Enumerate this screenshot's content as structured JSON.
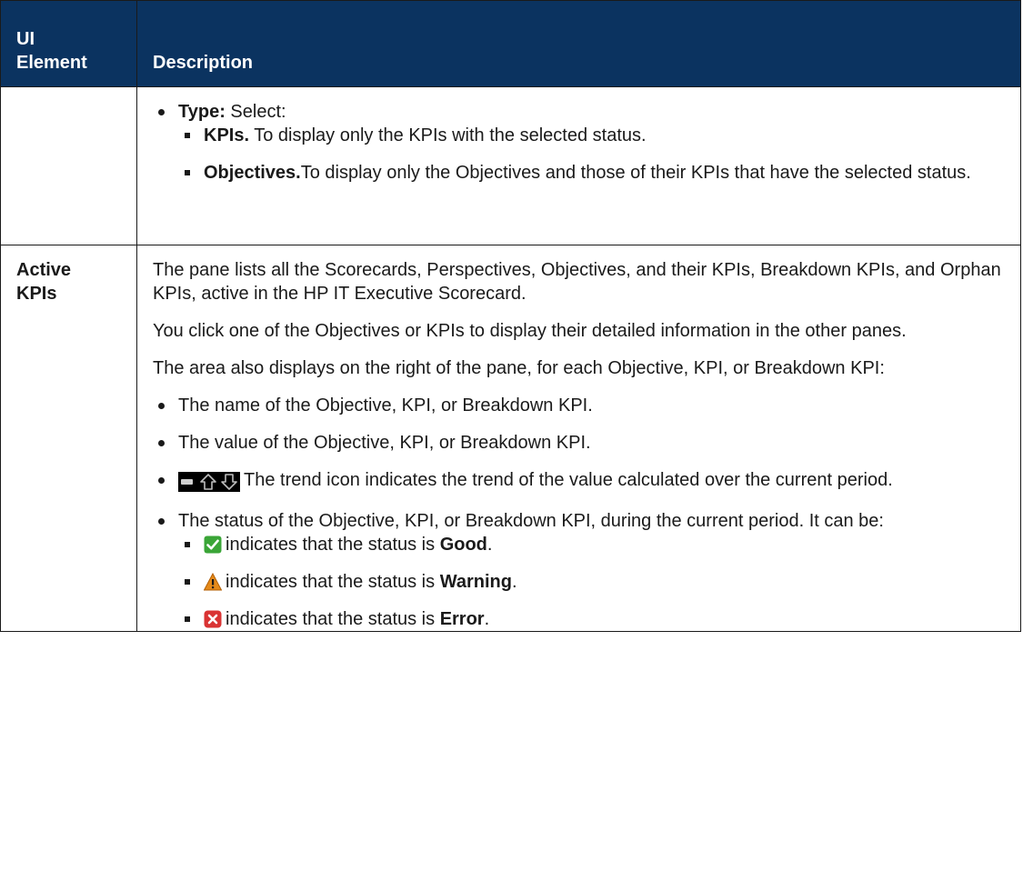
{
  "header": {
    "col1_line1": "UI",
    "col1_line2": "Element",
    "col2": "Description"
  },
  "row1": {
    "type_label": "Type:",
    "type_text": " Select:",
    "options": [
      {
        "label": "KPIs.",
        "text": " To display only the KPIs with the selected status."
      },
      {
        "label": "Objectives.",
        "text": "To display only the Objectives and those of their KPIs that have the selected status."
      }
    ]
  },
  "row2": {
    "element_line1": "Active",
    "element_line2": "KPIs",
    "paragraphs": [
      "The pane lists all the Scorecards, Perspectives, Objectives, and their KPIs, Breakdown KPIs, and Orphan KPIs, active in the HP IT Executive Scorecard.",
      "You click one of the Objectives or KPIs to display their detailed information in the other panes.",
      "The area also displays on the right of the pane, for each Objective, KPI, or Breakdown KPI:"
    ],
    "bullets": {
      "name": "The name of the Objective, KPI, or Breakdown KPI.",
      "value": "The value of the Objective, KPI, or Breakdown KPI.",
      "trend": "The trend icon indicates the trend of the value calculated over the current period.",
      "status": "The status of the Objective, KPI, or Breakdown KPI, during the current period. It can be:"
    },
    "status_items": [
      {
        "icon": "check-icon",
        "color": "#3aa537",
        "prefix": "indicates that the status is ",
        "status": "Good",
        "suffix": "."
      },
      {
        "icon": "warning-icon",
        "color": "#e58a1a",
        "prefix": "indicates that the status is ",
        "status": "Warning",
        "suffix": "."
      },
      {
        "icon": "error-icon",
        "color": "#d93333",
        "prefix": "indicates that the status is ",
        "status": "Error",
        "suffix": "."
      }
    ]
  }
}
